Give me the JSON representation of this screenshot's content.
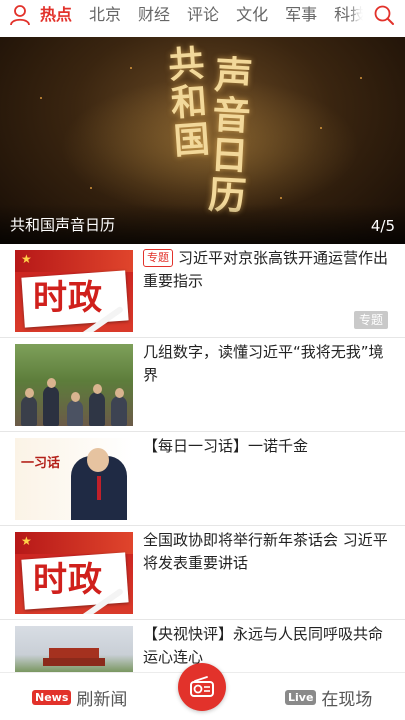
{
  "header": {
    "user_icon": "user-icon",
    "search_icon": "search-icon",
    "tabs": [
      {
        "label": "热点",
        "active": true
      },
      {
        "label": "北京",
        "active": false
      },
      {
        "label": "财经",
        "active": false
      },
      {
        "label": "评论",
        "active": false
      },
      {
        "label": "文化",
        "active": false
      },
      {
        "label": "军事",
        "active": false
      },
      {
        "label": "科技",
        "active": false
      }
    ],
    "accent_color": "#e2322b"
  },
  "banner": {
    "title": "共和国声音日历",
    "page_indicator": "4/5",
    "calligraphy_line1": "共和国",
    "calligraphy_line2": "声音日历"
  },
  "news": [
    {
      "badge": "专题",
      "title": "习近平对京张高铁开通运营作出重要指示",
      "tag": "专题",
      "thumb_text": "时政"
    },
    {
      "title": "几组数字，读懂习近平“我将无我”境界"
    },
    {
      "title": "【每日一习话】一诺千金",
      "thumb_text": "一习话"
    },
    {
      "title": "全国政协即将举行新年茶话会 习近平将发表重要讲话",
      "thumb_text": "时政"
    },
    {
      "title": "【央视快评】永远与人民同呼吸共命运心连心"
    }
  ],
  "bottom_bar": {
    "left_pill": "News",
    "left_label": "刷新闻",
    "center_icon": "radio-icon",
    "right_pill": "Live",
    "right_label": "在现场"
  }
}
